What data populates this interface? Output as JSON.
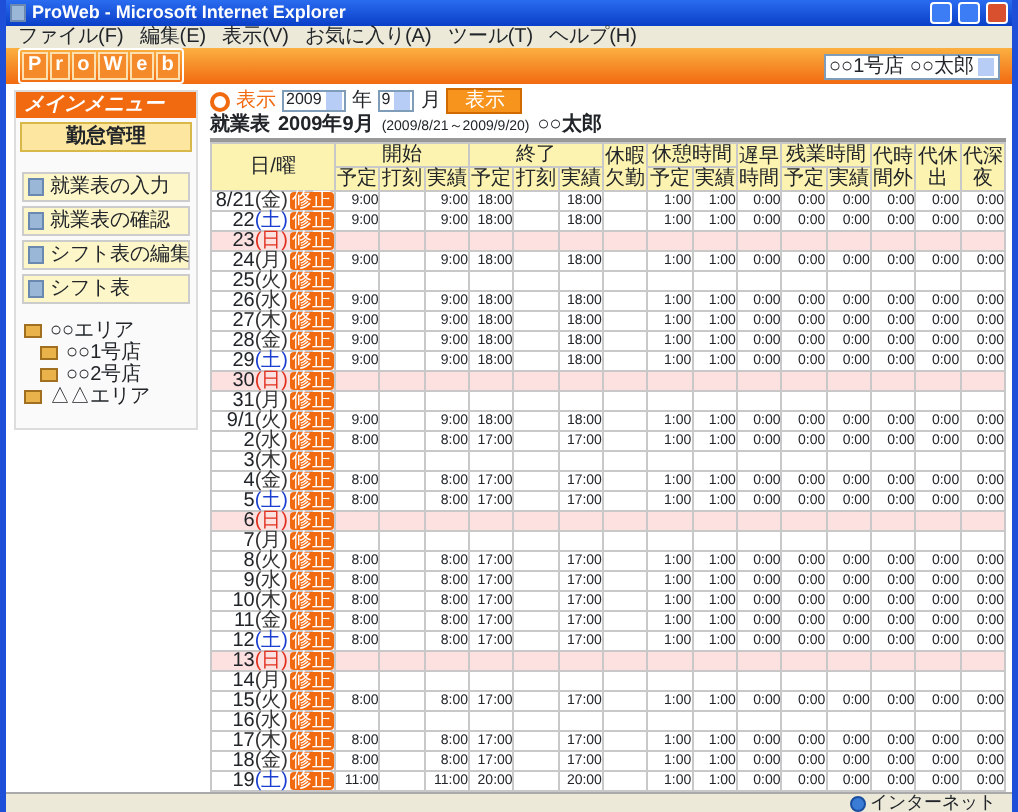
{
  "window": {
    "title": "ProWeb - Microsoft Internet Explorer"
  },
  "menu_bar": [
    "ファイル(F)",
    "編集(E)",
    "表示(V)",
    "お気に入り(A)",
    "ツール(T)",
    "ヘルプ(H)"
  ],
  "header": {
    "logo_letters": [
      "P",
      "r",
      "o",
      "W",
      "e",
      "b"
    ],
    "user_select": "○○1号店 ○○太郎"
  },
  "sidebar": {
    "title": "メインメニュー",
    "section": "勤怠管理",
    "items": [
      {
        "label": "就業表の入力"
      },
      {
        "label": "就業表の確認"
      },
      {
        "label": "シフト表の編集"
      },
      {
        "label": "シフト表"
      }
    ],
    "tree": [
      {
        "label": "○○エリア",
        "children": [
          {
            "label": "○○1号店"
          },
          {
            "label": "○○2号店"
          }
        ]
      },
      {
        "label": "△△エリア"
      }
    ]
  },
  "toolbar": {
    "label": "表示",
    "year": "2009",
    "year_unit": "年",
    "month": "9",
    "month_unit": "月",
    "button": "表示"
  },
  "heading": {
    "title": "就業表",
    "month": "2009年9月",
    "range": "(2009/8/21～2009/9/20)",
    "person": "○○太郎"
  },
  "table": {
    "columns": [
      {
        "label": "日/曜"
      },
      {
        "label": "開始",
        "sub": [
          "予定",
          "打刻",
          "実績"
        ]
      },
      {
        "label": "終了",
        "sub": [
          "予定",
          "打刻",
          "実績"
        ]
      },
      {
        "label": "休暇欠勤"
      },
      {
        "label": "休憩時間",
        "sub": [
          "予定",
          "実績"
        ]
      },
      {
        "label": "遅早時間"
      },
      {
        "label": "残業時間",
        "sub": [
          "予定",
          "実績"
        ]
      },
      {
        "label": "代時間外"
      },
      {
        "label": "代休出"
      },
      {
        "label": "代深夜"
      }
    ],
    "rows": [
      {
        "date": "8/21",
        "weekday": "(金)",
        "kind": "weekday",
        "edit": "修正",
        "cells": [
          "9:00",
          null,
          "9:00",
          "18:00",
          null,
          "18:00",
          null,
          "1:00",
          "1:00",
          "0:00",
          "0:00",
          "0:00",
          "0:00",
          "0:00",
          "0:00"
        ]
      },
      {
        "date": "22",
        "weekday": "(土)",
        "kind": "saturday",
        "edit": "修正",
        "cells": [
          "9:00",
          null,
          "9:00",
          "18:00",
          null,
          "18:00",
          null,
          "1:00",
          "1:00",
          "0:00",
          "0:00",
          "0:00",
          "0:00",
          "0:00",
          "0:00"
        ]
      },
      {
        "date": "23",
        "weekday": "(日)",
        "kind": "sunday",
        "edit": "修正"
      },
      {
        "date": "24",
        "weekday": "(月)",
        "kind": "weekday",
        "edit": "修正",
        "cells": [
          "9:00",
          null,
          "9:00",
          "18:00",
          null,
          "18:00",
          null,
          "1:00",
          "1:00",
          "0:00",
          "0:00",
          "0:00",
          "0:00",
          "0:00",
          "0:00"
        ]
      },
      {
        "date": "25",
        "weekday": "(火)",
        "kind": "weekday",
        "edit": "修正"
      },
      {
        "date": "26",
        "weekday": "(水)",
        "kind": "weekday",
        "edit": "修正",
        "cells": [
          "9:00",
          null,
          "9:00",
          "18:00",
          null,
          "18:00",
          null,
          "1:00",
          "1:00",
          "0:00",
          "0:00",
          "0:00",
          "0:00",
          "0:00",
          "0:00"
        ]
      },
      {
        "date": "27",
        "weekday": "(木)",
        "kind": "weekday",
        "edit": "修正",
        "cells": [
          "9:00",
          null,
          "9:00",
          "18:00",
          null,
          "18:00",
          null,
          "1:00",
          "1:00",
          "0:00",
          "0:00",
          "0:00",
          "0:00",
          "0:00",
          "0:00"
        ]
      },
      {
        "date": "28",
        "weekday": "(金)",
        "kind": "weekday",
        "edit": "修正",
        "cells": [
          "9:00",
          null,
          "9:00",
          "18:00",
          null,
          "18:00",
          null,
          "1:00",
          "1:00",
          "0:00",
          "0:00",
          "0:00",
          "0:00",
          "0:00",
          "0:00"
        ]
      },
      {
        "date": "29",
        "weekday": "(土)",
        "kind": "saturday",
        "edit": "修正",
        "cells": [
          "9:00",
          null,
          "9:00",
          "18:00",
          null,
          "18:00",
          null,
          "1:00",
          "1:00",
          "0:00",
          "0:00",
          "0:00",
          "0:00",
          "0:00",
          "0:00"
        ]
      },
      {
        "date": "30",
        "weekday": "(日)",
        "kind": "sunday",
        "edit": "修正"
      },
      {
        "date": "31",
        "weekday": "(月)",
        "kind": "weekday",
        "edit": "修正"
      },
      {
        "date": "9/1",
        "weekday": "(火)",
        "kind": "weekday",
        "edit": "修正",
        "cells": [
          "9:00",
          null,
          "9:00",
          "18:00",
          null,
          "18:00",
          null,
          "1:00",
          "1:00",
          "0:00",
          "0:00",
          "0:00",
          "0:00",
          "0:00",
          "0:00"
        ]
      },
      {
        "date": "2",
        "weekday": "(水)",
        "kind": "weekday",
        "edit": "修正",
        "cells": [
          "8:00",
          null,
          "8:00",
          "17:00",
          null,
          "17:00",
          null,
          "1:00",
          "1:00",
          "0:00",
          "0:00",
          "0:00",
          "0:00",
          "0:00",
          "0:00"
        ]
      },
      {
        "date": "3",
        "weekday": "(木)",
        "kind": "weekday",
        "edit": "修正"
      },
      {
        "date": "4",
        "weekday": "(金)",
        "kind": "weekday",
        "edit": "修正",
        "cells": [
          "8:00",
          null,
          "8:00",
          "17:00",
          null,
          "17:00",
          null,
          "1:00",
          "1:00",
          "0:00",
          "0:00",
          "0:00",
          "0:00",
          "0:00",
          "0:00"
        ]
      },
      {
        "date": "5",
        "weekday": "(土)",
        "kind": "saturday",
        "edit": "修正",
        "cells": [
          "8:00",
          null,
          "8:00",
          "17:00",
          null,
          "17:00",
          null,
          "1:00",
          "1:00",
          "0:00",
          "0:00",
          "0:00",
          "0:00",
          "0:00",
          "0:00"
        ]
      },
      {
        "date": "6",
        "weekday": "(日)",
        "kind": "sunday",
        "edit": "修正"
      },
      {
        "date": "7",
        "weekday": "(月)",
        "kind": "weekday",
        "edit": "修正"
      },
      {
        "date": "8",
        "weekday": "(火)",
        "kind": "weekday",
        "edit": "修正",
        "cells": [
          "8:00",
          null,
          "8:00",
          "17:00",
          null,
          "17:00",
          null,
          "1:00",
          "1:00",
          "0:00",
          "0:00",
          "0:00",
          "0:00",
          "0:00",
          "0:00"
        ]
      },
      {
        "date": "9",
        "weekday": "(水)",
        "kind": "weekday",
        "edit": "修正",
        "cells": [
          "8:00",
          null,
          "8:00",
          "17:00",
          null,
          "17:00",
          null,
          "1:00",
          "1:00",
          "0:00",
          "0:00",
          "0:00",
          "0:00",
          "0:00",
          "0:00"
        ]
      },
      {
        "date": "10",
        "weekday": "(木)",
        "kind": "weekday",
        "edit": "修正",
        "cells": [
          "8:00",
          null,
          "8:00",
          "17:00",
          null,
          "17:00",
          null,
          "1:00",
          "1:00",
          "0:00",
          "0:00",
          "0:00",
          "0:00",
          "0:00",
          "0:00"
        ]
      },
      {
        "date": "11",
        "weekday": "(金)",
        "kind": "weekday",
        "edit": "修正",
        "cells": [
          "8:00",
          null,
          "8:00",
          "17:00",
          null,
          "17:00",
          null,
          "1:00",
          "1:00",
          "0:00",
          "0:00",
          "0:00",
          "0:00",
          "0:00",
          "0:00"
        ]
      },
      {
        "date": "12",
        "weekday": "(土)",
        "kind": "saturday",
        "edit": "修正",
        "cells": [
          "8:00",
          null,
          "8:00",
          "17:00",
          null,
          "17:00",
          null,
          "1:00",
          "1:00",
          "0:00",
          "0:00",
          "0:00",
          "0:00",
          "0:00",
          "0:00"
        ]
      },
      {
        "date": "13",
        "weekday": "(日)",
        "kind": "sunday",
        "edit": "修正"
      },
      {
        "date": "14",
        "weekday": "(月)",
        "kind": "weekday",
        "edit": "修正"
      },
      {
        "date": "15",
        "weekday": "(火)",
        "kind": "weekday",
        "edit": "修正",
        "cells": [
          "8:00",
          null,
          "8:00",
          "17:00",
          null,
          "17:00",
          null,
          "1:00",
          "1:00",
          "0:00",
          "0:00",
          "0:00",
          "0:00",
          "0:00",
          "0:00"
        ]
      },
      {
        "date": "16",
        "weekday": "(水)",
        "kind": "weekday",
        "edit": "修正"
      },
      {
        "date": "17",
        "weekday": "(木)",
        "kind": "weekday",
        "edit": "修正",
        "cells": [
          "8:00",
          null,
          "8:00",
          "17:00",
          null,
          "17:00",
          null,
          "1:00",
          "1:00",
          "0:00",
          "0:00",
          "0:00",
          "0:00",
          "0:00",
          "0:00"
        ]
      },
      {
        "date": "18",
        "weekday": "(金)",
        "kind": "weekday",
        "edit": "修正",
        "cells": [
          "8:00",
          null,
          "8:00",
          "17:00",
          null,
          "17:00",
          null,
          "1:00",
          "1:00",
          "0:00",
          "0:00",
          "0:00",
          "0:00",
          "0:00",
          "0:00"
        ]
      },
      {
        "date": "19",
        "weekday": "(土)",
        "kind": "saturday",
        "edit": "修正",
        "cells": [
          "11:00",
          null,
          "11:00",
          "20:00",
          null,
          "20:00",
          null,
          "1:00",
          "1:00",
          "0:00",
          "0:00",
          "0:00",
          "0:00",
          "0:00",
          "0:00"
        ]
      }
    ]
  },
  "status_bar": {
    "zone": "インターネット"
  }
}
